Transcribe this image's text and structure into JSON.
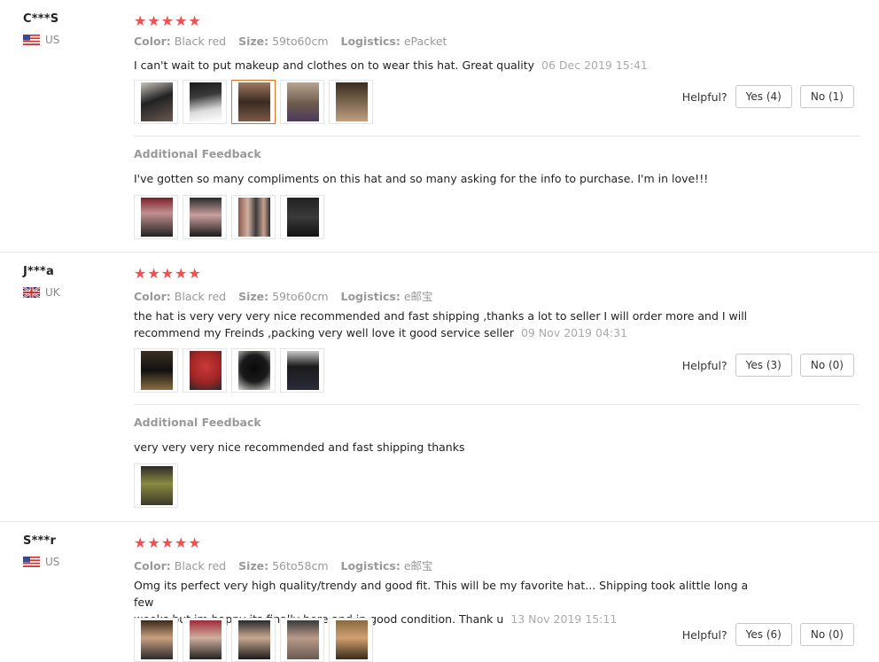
{
  "reviews": [
    {
      "user": "C***S",
      "country": "US",
      "rating_stars": 5,
      "color_label": "Color:",
      "color_value": "Black red",
      "size_label": "Size:",
      "size_value": "59to60cm",
      "logistics_label": "Logistics:",
      "logistics_value": "ePacket",
      "text": "I can't wait to put makeup and clothes on to wear this hat. Great quality",
      "date": "06 Dec 2019 15:41",
      "helpful_label": "Helpful?",
      "yes_label": "Yes (4)",
      "no_label": "No (1)",
      "additional_label": "Additional Feedback",
      "additional_text": "I've gotten so many compliments on this hat and so many asking for the info to purchase. I'm in love!!!"
    },
    {
      "user": "J***a",
      "country": "UK",
      "rating_stars": 5,
      "color_label": "Color:",
      "color_value": "Black red",
      "size_label": "Size:",
      "size_value": "59to60cm",
      "logistics_label": "Logistics:",
      "logistics_value": "e邮宝",
      "text_line1": "the hat is very very very nice recommended and fast shipping ,thanks a lot to seller I will order more and I will",
      "text_line2": "recommend my Freinds ,packing very well love it good service seller",
      "date": "09 Nov 2019 04:31",
      "helpful_label": "Helpful?",
      "yes_label": "Yes (3)",
      "no_label": "No (0)",
      "additional_label": "Additional Feedback",
      "additional_text": "very very very nice recommended and fast shipping thanks"
    },
    {
      "user": "S***r",
      "country": "US",
      "rating_stars": 5,
      "color_label": "Color:",
      "color_value": "Black red",
      "size_label": "Size:",
      "size_value": "56to58cm",
      "logistics_label": "Logistics:",
      "logistics_value": "e邮宝",
      "text_line1": "Omg its perfect very high quality/trendy and good fit. This will be my favorite hat... Shipping took alittle long a few",
      "text_line2": "weeks but im happy its finally here and in good condition. Thank u",
      "date": "13 Nov 2019 15:11",
      "helpful_label": "Helpful?",
      "yes_label": "Yes (6)",
      "no_label": "No (0)"
    }
  ],
  "colors": {
    "star": "#f05050",
    "selected_thumb_border": "#e07020"
  }
}
